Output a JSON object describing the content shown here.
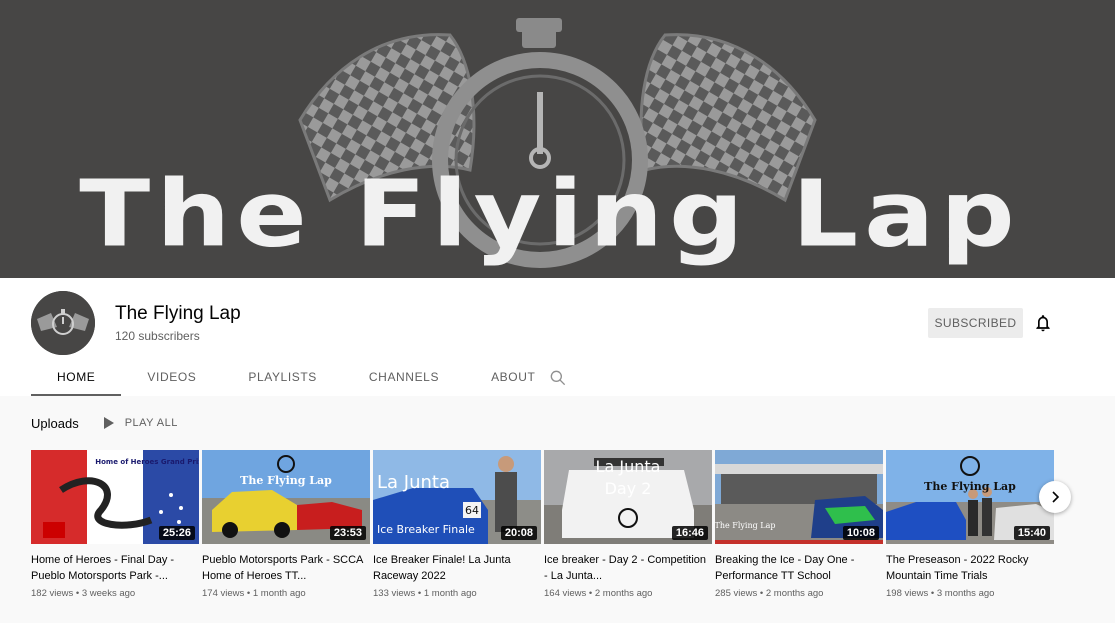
{
  "banner": {
    "title": "The Flying Lap"
  },
  "channel": {
    "name": "The Flying Lap",
    "subscribers": "120 subscribers",
    "subscribed_label": "SUBSCRIBED"
  },
  "tabs": [
    {
      "label": "HOME",
      "active": true
    },
    {
      "label": "VIDEOS"
    },
    {
      "label": "PLAYLISTS"
    },
    {
      "label": "CHANNELS"
    },
    {
      "label": "ABOUT"
    }
  ],
  "uploads": {
    "title": "Uploads",
    "play_all": "PLAY ALL"
  },
  "videos": [
    {
      "title": "Home of Heroes - Final Day - Pueblo Motorsports Park -...",
      "views": "182 views",
      "age": "3 weeks ago",
      "duration": "25:26",
      "thumb_text": "Home of Heroes Grand Prix"
    },
    {
      "title": "Pueblo Motorsports Park - SCCA Home of Heroes TT...",
      "views": "174 views",
      "age": "1 month ago",
      "duration": "23:53",
      "thumb_text": "The Flying Lap"
    },
    {
      "title": "Ice Breaker Finale! La Junta Raceway 2022",
      "views": "133 views",
      "age": "1 month ago",
      "duration": "20:08",
      "thumb_text": "La Junta",
      "thumb_sub": "Ice Breaker Finale",
      "thumb_num": "64"
    },
    {
      "title": "Ice breaker - Day 2 - Competition - La Junta...",
      "views": "164 views",
      "age": "2 months ago",
      "duration": "16:46",
      "thumb_text": "La Junta",
      "thumb_sub": "Day 2"
    },
    {
      "title": "Breaking the Ice - Day One - Performance TT School",
      "views": "285 views",
      "age": "2 months ago",
      "duration": "10:08",
      "thumb_text": "The Flying Lap"
    },
    {
      "title": "The Preseason - 2022 Rocky Mountain Time Trials",
      "views": "198 views",
      "age": "3 months ago",
      "duration": "15:40",
      "thumb_text": "The Flying Lap"
    }
  ],
  "colors": {
    "banner_bg": "#474645",
    "accent_red": "#cc0000"
  }
}
